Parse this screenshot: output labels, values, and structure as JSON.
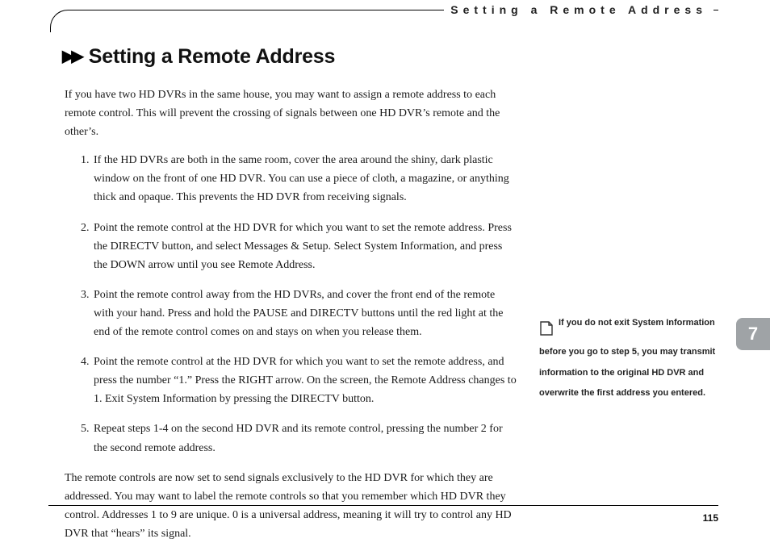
{
  "running_head": "Setting a Remote Address",
  "title_arrows": "▶▶",
  "title": "Setting a Remote Address",
  "intro": "If you have two HD DVRs in the same house, you may want to assign a remote address to each remote control. This will prevent the crossing of signals between one HD DVR’s remote and the other’s.",
  "steps": [
    "If the HD DVRs are both in the same room, cover the area around the shiny, dark plastic window on the front of one HD DVR. You can use a piece of cloth, a magazine, or anything thick and opaque. This prevents the HD DVR from receiving signals.",
    "Point the remote control at the HD DVR for which you want to set the remote address. Press the DIRECTV button, and select Messages & Setup. Select System Information, and press the DOWN arrow until you see Remote Address.",
    "Point the remote control away from the HD DVRs, and cover the front end of the remote with your hand. Press and hold the PAUSE and DIRECTV buttons until the red light at the end of the remote control comes on and stays on when you release them.",
    "Point the remote control at the HD DVR for which you want to set the remote address, and press the number “1.” Press the RIGHT arrow. On the screen, the Remote Address changes to 1. Exit System Information by pressing the DIRECTV button.",
    "Repeat steps 1-4 on the second HD DVR and its remote control, pressing the number 2 for the second remote address."
  ],
  "outro": "The remote controls are now set to send signals exclusively to the HD DVR for which they are addressed. You may want to label the remote controls so that you remember which HD DVR they control. Addresses 1 to 9 are unique. 0 is a universal address, meaning it will try to control any HD DVR that “hears” its signal.",
  "sidenote": "If you do not exit System Information before you go to step 5, you may transmit information to the original HD DVR and overwrite the first address you entered.",
  "chapter_number": "7",
  "page_number": "115"
}
